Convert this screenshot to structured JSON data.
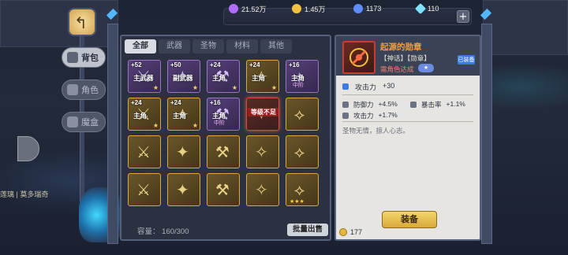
{
  "currencies": [
    {
      "icon": "purple-orb-icon",
      "value": "21.52万",
      "color": "#b06cff"
    },
    {
      "icon": "gold-coin-icon",
      "value": "1.45万",
      "color": "#f2c13d"
    },
    {
      "icon": "blue-token-icon",
      "value": "1173",
      "color": "#5f8cff"
    },
    {
      "icon": "diamond-icon",
      "value": "110",
      "color": "#7fe3ff"
    }
  ],
  "nav": {
    "bag": "背包",
    "character": "角色",
    "magic_box": "魔盒"
  },
  "side_text": "莲璃 | 莫多瑞奇",
  "inventory": {
    "tabs": [
      "全部",
      "武器",
      "圣物",
      "材料",
      "其他"
    ],
    "active_tab": "全部",
    "slots": [
      {
        "level": "+52",
        "label": "主武器",
        "sub": "",
        "rarity": "purple",
        "overlay": "",
        "star": true
      },
      {
        "level": "+50",
        "label": "副武器",
        "sub": "",
        "rarity": "purple",
        "overlay": "",
        "star": true
      },
      {
        "level": "+24",
        "label": "主角",
        "sub": "",
        "rarity": "purple",
        "overlay": "",
        "star": true
      },
      {
        "level": "+24",
        "label": "主角",
        "sub": "",
        "rarity": "gold",
        "overlay": "",
        "star": true
      },
      {
        "level": "+16",
        "label": "主角",
        "sub": "中阶",
        "rarity": "purple",
        "overlay": "",
        "star": false
      },
      {
        "level": "+24",
        "label": "主角",
        "sub": "",
        "rarity": "gold",
        "overlay": "",
        "star": true
      },
      {
        "level": "+24",
        "label": "主角",
        "sub": "",
        "rarity": "gold",
        "overlay": "",
        "star": true
      },
      {
        "level": "+16",
        "label": "主角",
        "sub": "中阶",
        "rarity": "purple",
        "overlay": "",
        "star": false
      },
      {
        "level": "",
        "label": "",
        "sub": "",
        "rarity": "red",
        "overlay": "等级不足",
        "star": false
      },
      {
        "level": "",
        "label": "",
        "sub": "",
        "rarity": "gold",
        "overlay": "",
        "star": false
      },
      {
        "level": "",
        "label": "",
        "sub": "",
        "rarity": "gold",
        "overlay": "",
        "star": false
      },
      {
        "level": "",
        "label": "",
        "sub": "",
        "rarity": "gold",
        "overlay": "",
        "star": false
      },
      {
        "level": "",
        "label": "",
        "sub": "",
        "rarity": "gold",
        "overlay": "",
        "star": false
      },
      {
        "level": "",
        "label": "",
        "sub": "",
        "rarity": "gold",
        "overlay": "",
        "star": false
      },
      {
        "level": "",
        "label": "",
        "sub": "",
        "rarity": "gold",
        "overlay": "",
        "star": false
      },
      {
        "level": "",
        "label": "",
        "sub": "",
        "rarity": "gold",
        "overlay": "",
        "star": false
      },
      {
        "level": "",
        "label": "",
        "sub": "",
        "rarity": "gold",
        "overlay": "",
        "star": false
      },
      {
        "level": "",
        "label": "",
        "sub": "",
        "rarity": "gold",
        "overlay": "",
        "star": false
      },
      {
        "level": "",
        "label": "",
        "sub": "",
        "rarity": "gold",
        "overlay": "",
        "star": false
      },
      {
        "level": "",
        "label": "",
        "sub": "",
        "rarity": "gold",
        "overlay": "",
        "star": false,
        "three_stars": true
      }
    ],
    "capacity_label": "容量：",
    "capacity_value": "160/300",
    "sell_button": "批量出售"
  },
  "detail": {
    "title": "起源的勋章",
    "type": "【神话】【勋章】",
    "requirement": "需角色达成",
    "badge": "已装备",
    "main_stat_name": "攻击力",
    "main_stat_value": "+30",
    "stats": [
      {
        "name": "防御力",
        "value": "+4.5%"
      },
      {
        "name": "暴击率",
        "value": "+1.1%"
      },
      {
        "name": "攻击力",
        "value": "+1.7%"
      }
    ],
    "description": "圣物无情，掠人心志。",
    "equip_button": "装备",
    "sell_price": "177"
  }
}
